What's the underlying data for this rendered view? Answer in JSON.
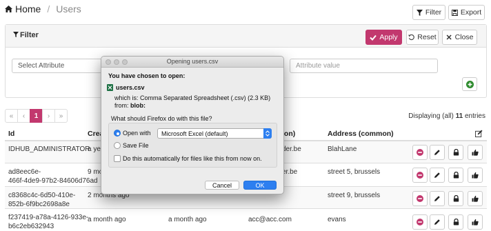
{
  "breadcrumb": {
    "home": "Home",
    "current": "Users"
  },
  "toolbar": {
    "filter": "Filter",
    "export": "Export"
  },
  "filter_panel": {
    "title": "Filter",
    "apply": "Apply",
    "reset": "Reset",
    "close": "Close",
    "attribute_select": "Select Attribute",
    "attribute_value_placeholder": "Attribute value"
  },
  "pager": {
    "first": "«",
    "prev": "‹",
    "page": "1",
    "next": "›",
    "last": "»"
  },
  "displaying": {
    "prefix": "Displaying (all) ",
    "count": "11",
    "suffix": " entries"
  },
  "table": {
    "columns": {
      "id": "Id",
      "created": "Crea",
      "email": "ion)",
      "address": "Address (common)"
    },
    "rows": [
      {
        "id_line1": "IDHUB_ADMINISTRATOR",
        "id_line2": "",
        "created": "a yea",
        "email": "der.be",
        "address": "BlahLane"
      },
      {
        "id_line1": "ad8eec6e-",
        "id_line2": "466f-4de9-97b2-84606d76ad",
        "created": "9 mo",
        "email": "er.be",
        "address": "street 5, brussels"
      },
      {
        "id_line1": "c8368c4c-6d50-410e-",
        "id_line2": "852b-6f9bc2698a8e",
        "created": "2 months ago",
        "email": "",
        "address": "street 9, brussels"
      },
      {
        "id_line1": "f237419-a78a-4126-933e-",
        "id_line2": "b6c2eb632943",
        "created": "a month ago",
        "modified": "a month ago",
        "email": "acc@acc.com",
        "address": "evans"
      }
    ]
  },
  "dialog": {
    "title": "Opening users.csv",
    "chosen": "You have chosen to open:",
    "filename": "users.csv",
    "which_is": "which is:  Comma Separated Spreadsheet (.csv) (2.3 KB)",
    "from_label": "from:",
    "from_value": "blob:",
    "question": "What should Firefox do with this file?",
    "open_with": "Open with",
    "app": "Microsoft Excel (default)",
    "save_file": "Save File",
    "auto": "Do this automatically for files like this from now on.",
    "cancel": "Cancel",
    "ok": "OK"
  },
  "colors": {
    "accent": "#c2386e",
    "danger": "#c2386e",
    "mac_blue": "#2d7ff0",
    "excel_green": "#1e7145",
    "add_green": "#2e8b2e"
  }
}
